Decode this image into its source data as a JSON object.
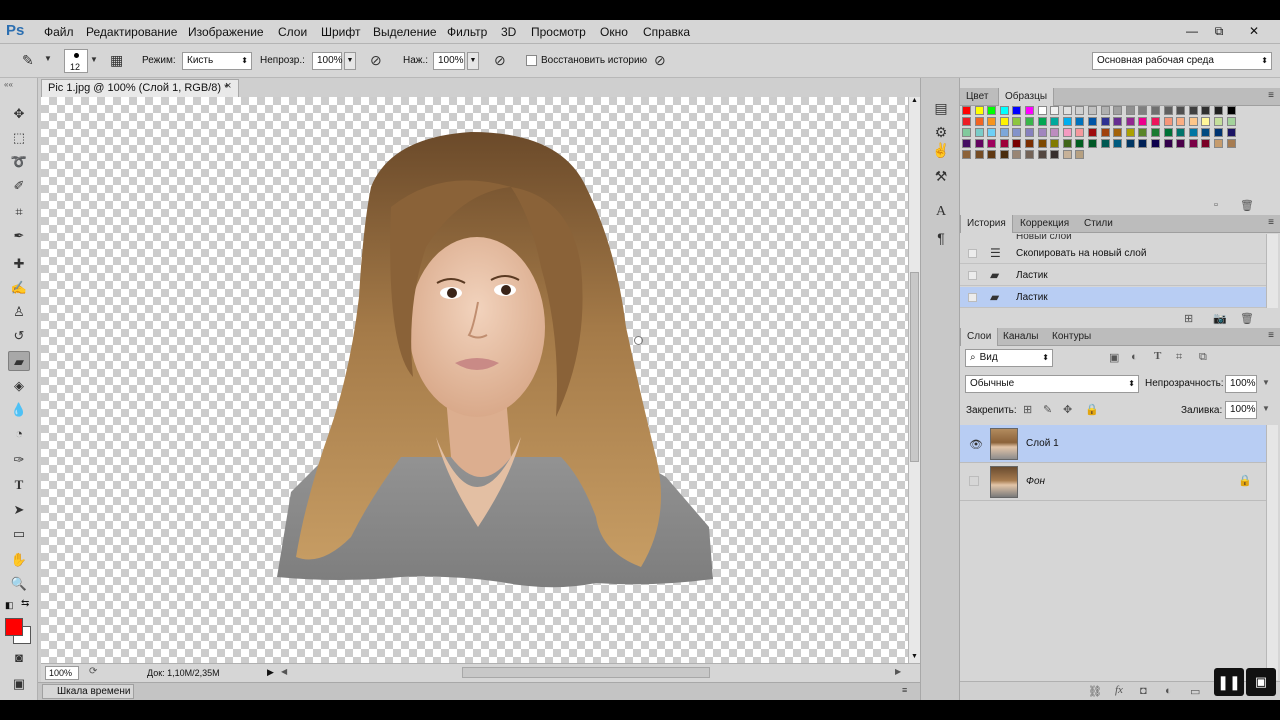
{
  "app": {
    "logo": "Ps"
  },
  "menu": [
    "Файл",
    "Редактирование",
    "Изображение",
    "Слои",
    "Шрифт",
    "Выделение",
    "Фильтр",
    "3D",
    "Просмотр",
    "Окно",
    "Справка"
  ],
  "window_controls": {
    "minimize": "—",
    "restore": "⧉",
    "close": "✕"
  },
  "options": {
    "brush_size": "12",
    "mode_label": "Режим:",
    "mode_value": "Кисть",
    "opacity_label": "Непрозр.:",
    "opacity_value": "100%",
    "pressure_label": "Наж.:",
    "pressure_value": "100%",
    "restore_history": "Восстановить историю",
    "workspace": "Основная рабочая среда"
  },
  "document": {
    "tab_title": "Pic 1.jpg @ 100% (Слой 1, RGB/8) *",
    "close": "×",
    "zoom": "100%",
    "doc_size": "Док: 1,10M/2,35M"
  },
  "timeline": {
    "label": "Шкала времени"
  },
  "panels": {
    "color_tabs": [
      "Цвет",
      "Образцы"
    ],
    "history_tabs": [
      "История",
      "Коррекция",
      "Стили"
    ],
    "layers_tabs": [
      "Слои",
      "Каналы",
      "Контуры"
    ]
  },
  "swatch_colors": [
    "#ff0000",
    "#ffff00",
    "#00ff00",
    "#00ffff",
    "#0000ff",
    "#ff00ff",
    "#ffffff",
    "#f0f0f0",
    "#e0e0e0",
    "#d0d0d0",
    "#c0c0c0",
    "#b0b0b0",
    "#a0a0a0",
    "#909090",
    "#808080",
    "#707070",
    "#606060",
    "#505050",
    "#404040",
    "#303030",
    "#202020",
    "#000000",
    "#ed1c24",
    "#f26522",
    "#f7941d",
    "#fff200",
    "#8dc63f",
    "#39b54a",
    "#00a651",
    "#00a99d",
    "#00aeef",
    "#0072bc",
    "#0054a6",
    "#2e3192",
    "#662d91",
    "#92278f",
    "#ec008c",
    "#ed145b",
    "#f69679",
    "#fbad82",
    "#fdc689",
    "#fff799",
    "#c4df9b",
    "#a3d39c",
    "#82ca9c",
    "#7accc8",
    "#6dcff6",
    "#7da7d9",
    "#8393ca",
    "#8781bd",
    "#a186be",
    "#bd8cbf",
    "#f49ac1",
    "#f5989d",
    "#9e0b0f",
    "#a0410d",
    "#a3620a",
    "#aba000",
    "#598527",
    "#197b30",
    "#007236",
    "#00746b",
    "#0076a3",
    "#004a80",
    "#003471",
    "#1b1464",
    "#440e62",
    "#630460",
    "#9e005d",
    "#9e0039",
    "#790000",
    "#7b2e00",
    "#7d4900",
    "#827b00",
    "#406618",
    "#005e20",
    "#005826",
    "#005952",
    "#005b7f",
    "#003663",
    "#002157",
    "#0d004c",
    "#32004b",
    "#4b0049",
    "#7b0046",
    "#7a0026",
    "#c69c6d",
    "#a67c52",
    "#8c6239",
    "#754c24",
    "#603913",
    "#4a2c0e",
    "#998675",
    "#736357",
    "#534741",
    "#362f2d",
    "#c7b299",
    "#b6a081"
  ],
  "history": [
    {
      "label": "Скопировать на новый слой",
      "icon": "document-icon"
    },
    {
      "label": "Ластик",
      "icon": "eraser-icon"
    },
    {
      "label": "Ластик",
      "icon": "eraser-icon"
    }
  ],
  "history_partial": "Новый слой",
  "layers_panel": {
    "filter_label": "Вид",
    "blend_mode": "Обычные",
    "opacity_label": "Непрозрачность:",
    "opacity_value": "100%",
    "lock_label": "Закрепить:",
    "fill_label": "Заливка:",
    "fill_value": "100%",
    "layers": [
      {
        "name": "Слой 1",
        "visible": true,
        "active": true,
        "locked": false
      },
      {
        "name": "Фон",
        "visible": false,
        "active": false,
        "locked": true
      }
    ]
  },
  "colors": {
    "foreground": "#ff0000",
    "background": "#ffffff",
    "selection": "#b8cdf3"
  }
}
